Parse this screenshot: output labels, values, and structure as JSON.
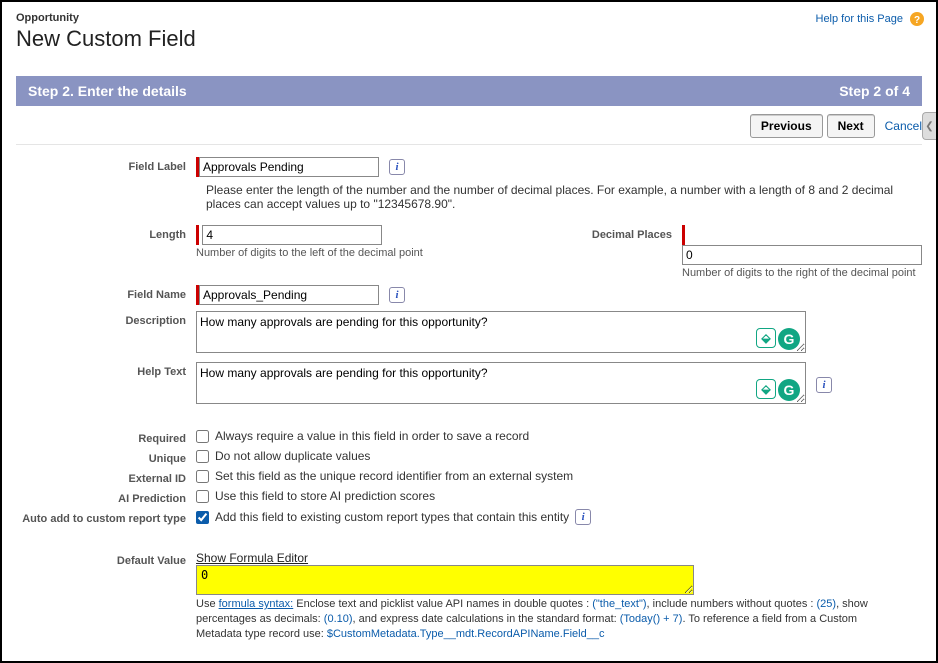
{
  "header": {
    "subtitle": "Opportunity",
    "title": "New Custom Field",
    "help_link": "Help for this Page"
  },
  "banner": {
    "left": "Step 2. Enter the details",
    "right": "Step 2 of 4"
  },
  "buttons": {
    "previous": "Previous",
    "next": "Next",
    "cancel": "Cancel"
  },
  "form": {
    "field_label": {
      "label": "Field Label",
      "value": "Approvals Pending"
    },
    "length_note": "Please enter the length of the number and the number of decimal places. For example, a number with a length of 8 and 2 decimal places can accept values up to \"12345678.90\".",
    "length": {
      "label": "Length",
      "value": "4",
      "hint": "Number of digits to the left of the decimal point"
    },
    "decimal_places": {
      "label": "Decimal Places",
      "value": "0",
      "hint": "Number of digits to the right of the decimal point"
    },
    "field_name": {
      "label": "Field Name",
      "value": "Approvals_Pending"
    },
    "description": {
      "label": "Description",
      "value": "How many approvals are pending for this opportunity?"
    },
    "help_text": {
      "label": "Help Text",
      "value": "How many approvals are pending for this opportunity?"
    },
    "checkboxes": {
      "required": {
        "label": "Required",
        "text": "Always require a value in this field in order to save a record"
      },
      "unique": {
        "label": "Unique",
        "text": "Do not allow duplicate values"
      },
      "external_id": {
        "label": "External ID",
        "text": "Set this field as the unique record identifier from an external system"
      },
      "ai_prediction": {
        "label": "AI Prediction",
        "text": "Use this field to store AI prediction scores"
      },
      "auto_add": {
        "label": "Auto add to custom report type",
        "text": "Add this field to existing custom report types that contain this entity"
      }
    },
    "default_value": {
      "label": "Default Value",
      "show_editor": "Show Formula Editor",
      "value": "0",
      "syntax": {
        "pre": "Use ",
        "link": "formula syntax:",
        "t1": " Enclose text and picklist value API names in double quotes : ",
        "ex1": "(\"the_text\")",
        "t2": ", include numbers without quotes : ",
        "ex2": "(25)",
        "t3": ", show percentages as decimals: ",
        "ex3": "(0.10)",
        "t4": ", and express date calculations in the standard format: ",
        "ex4": "(Today() + 7)",
        "t5": ". To reference a field from a Custom Metadata type record use: ",
        "ex5": "$CustomMetadata.Type__mdt.RecordAPIName.Field__c"
      }
    }
  }
}
